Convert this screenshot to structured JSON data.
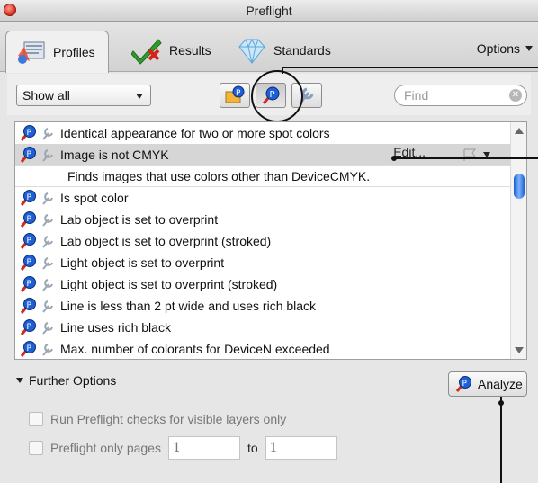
{
  "window": {
    "title": "Preflight"
  },
  "tabs": [
    {
      "label": "Profiles",
      "icon": "profiles-icon"
    },
    {
      "label": "Results",
      "icon": "results-checkmark-icon"
    },
    {
      "label": "Standards",
      "icon": "standards-diamond-icon"
    }
  ],
  "options_label": "Options",
  "toolbar": {
    "filter_selected": "Show all",
    "find_placeholder": "Find"
  },
  "list": {
    "items": [
      {
        "label": "Identical appearance for two or more spot colors"
      },
      {
        "label": "Image is not CMYK",
        "selected": true,
        "edit_label": "Edit...",
        "description": "Finds images that use colors other than DeviceCMYK."
      },
      {
        "label": "Is spot color"
      },
      {
        "label": "Lab object is set to overprint"
      },
      {
        "label": "Lab object is set to overprint (stroked)"
      },
      {
        "label": "Light object is set to overprint"
      },
      {
        "label": "Light object is set to overprint (stroked)"
      },
      {
        "label": "Line is less than 2 pt wide and uses rich black"
      },
      {
        "label": "Line uses rich black"
      },
      {
        "label": "Max. number of colorants for DeviceN exceeded"
      }
    ]
  },
  "further_options": {
    "label": "Further Options",
    "analyze_label": "Analyze",
    "visible_layers_label": "Run Preflight checks for visible layers only",
    "pages_label": "Preflight only pages",
    "pages_from": "1",
    "pages_to_label": "to",
    "pages_to": "1"
  },
  "colors": {
    "accent": "#1a5fd0",
    "close": "#e0382b"
  }
}
